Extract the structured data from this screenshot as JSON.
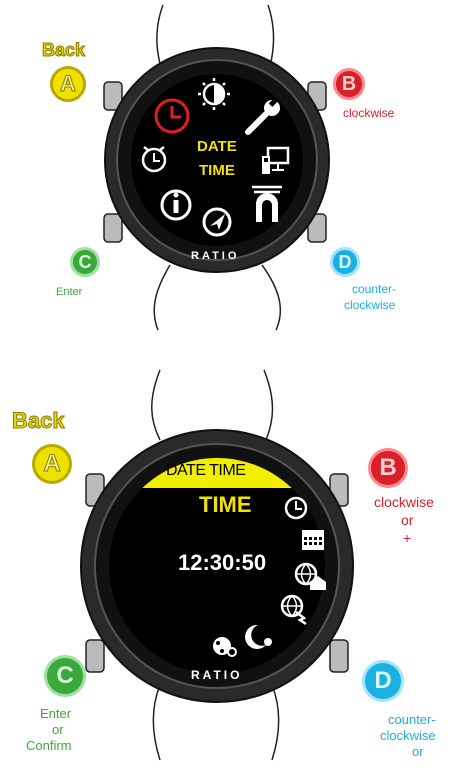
{
  "top": {
    "back_label": "Back",
    "button_a": "A",
    "button_b": "B",
    "button_b_action": "clockwise",
    "button_c": "C",
    "button_c_action": "Enter",
    "button_d": "D",
    "button_d_action_line1": "counter-",
    "button_d_action_line2": "clockwise",
    "screen_line1": "DATE",
    "screen_line2": "TIME",
    "brand": "RATIO",
    "menu_icons": [
      "clock-icon",
      "brightness-icon",
      "wrench-icon",
      "alarm-icon",
      "computer-icon",
      "info-icon",
      "navigation-icon",
      "arch-icon"
    ]
  },
  "bottom": {
    "back_label": "Back",
    "button_a": "A",
    "button_b": "B",
    "button_b_action_line1": "clockwise",
    "button_b_action_line2": "or",
    "button_b_action_line3": "+",
    "button_c": "C",
    "button_c_action_line1": "Enter",
    "button_c_action_line2": "or",
    "button_c_action_line3": "Confirm",
    "button_d": "D",
    "button_d_action_line1": "counter-",
    "button_d_action_line2": "clockwise",
    "button_d_action_line3": "or",
    "screen_header": "DATE TIME",
    "screen_title": "TIME",
    "screen_time": "12:30:50",
    "brand": "RATIO"
  },
  "colors": {
    "yellow": "#f0e000",
    "red": "#d8202a",
    "green": "#3aa83a",
    "cyan": "#1ab0e0"
  }
}
